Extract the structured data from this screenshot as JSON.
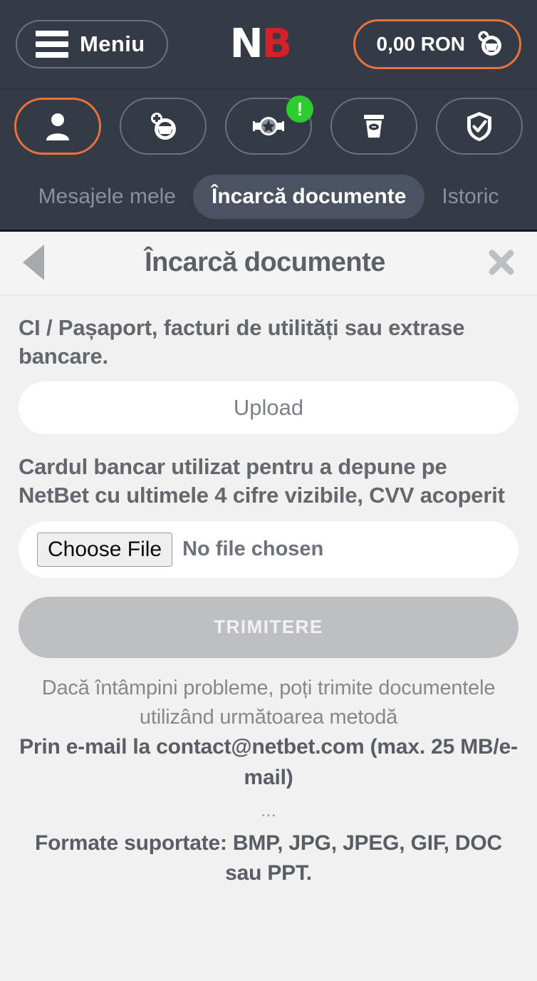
{
  "topbar": {
    "menu_label": "Meniu",
    "logo_first": "N",
    "logo_second": "B",
    "balance": "0,00 RON",
    "wallet_icon": "deposit-wallet-icon"
  },
  "icon_nav": {
    "items": [
      {
        "name": "account",
        "icon": "user-icon",
        "active": true,
        "badge": ""
      },
      {
        "name": "deposit",
        "icon": "wallet-plus-icon",
        "active": false,
        "badge": ""
      },
      {
        "name": "bonus",
        "icon": "star-rosette-icon",
        "active": false,
        "badge": "!"
      },
      {
        "name": "withdraw",
        "icon": "cash-dispenser-icon",
        "active": false,
        "badge": ""
      },
      {
        "name": "verification",
        "icon": "shield-check-icon",
        "active": false,
        "badge": ""
      }
    ]
  },
  "tabs": [
    {
      "label": "Mesajele mele",
      "active": false
    },
    {
      "label": "Încarcă documente",
      "active": true
    },
    {
      "label": "Istoric",
      "active": false
    }
  ],
  "page_header": {
    "title": "Încarcă documente",
    "back_icon": "back-triangle-icon",
    "close_icon": "close-icon"
  },
  "main": {
    "desc_identity": "CI / Pașaport, facturi de utilități sau extrase bancare.",
    "upload_label": "Upload",
    "desc_card": "Cardul bancar utilizat pentru a depune pe NetBet cu ultimele 4 cifre vizibile, CVV acoperit",
    "choose_file_label": "Choose File",
    "no_file_label": "No file chosen",
    "submit_label": "TRIMITERE",
    "help_line1": "Dacă întâmpini probleme, poți trimite documentele utilizând următoarea metodă",
    "help_email": "Prin e-mail la contact@netbet.com (max. 25 MB/e-mail)",
    "separator": "...",
    "formats": "Formate suportate: BMP, JPG, JPEG, GIF, DOC sau PPT."
  },
  "colors": {
    "header_bg": "#343a46",
    "accent_orange": "#e8733a",
    "logo_red": "#d42027",
    "badge_green": "#2fcc2f",
    "page_bg": "#f1f1f1",
    "disabled_grey": "#bdbfc3"
  }
}
